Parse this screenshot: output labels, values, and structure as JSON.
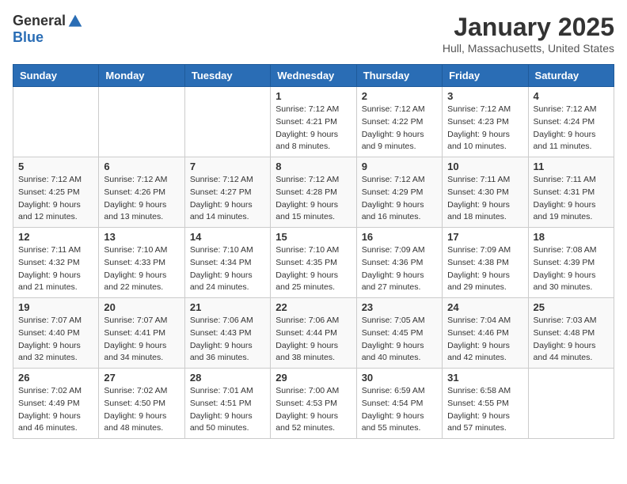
{
  "header": {
    "logo_general": "General",
    "logo_blue": "Blue",
    "month": "January 2025",
    "location": "Hull, Massachusetts, United States"
  },
  "weekdays": [
    "Sunday",
    "Monday",
    "Tuesday",
    "Wednesday",
    "Thursday",
    "Friday",
    "Saturday"
  ],
  "weeks": [
    [
      {
        "day": "",
        "info": ""
      },
      {
        "day": "",
        "info": ""
      },
      {
        "day": "",
        "info": ""
      },
      {
        "day": "1",
        "info": "Sunrise: 7:12 AM\nSunset: 4:21 PM\nDaylight: 9 hours\nand 8 minutes."
      },
      {
        "day": "2",
        "info": "Sunrise: 7:12 AM\nSunset: 4:22 PM\nDaylight: 9 hours\nand 9 minutes."
      },
      {
        "day": "3",
        "info": "Sunrise: 7:12 AM\nSunset: 4:23 PM\nDaylight: 9 hours\nand 10 minutes."
      },
      {
        "day": "4",
        "info": "Sunrise: 7:12 AM\nSunset: 4:24 PM\nDaylight: 9 hours\nand 11 minutes."
      }
    ],
    [
      {
        "day": "5",
        "info": "Sunrise: 7:12 AM\nSunset: 4:25 PM\nDaylight: 9 hours\nand 12 minutes."
      },
      {
        "day": "6",
        "info": "Sunrise: 7:12 AM\nSunset: 4:26 PM\nDaylight: 9 hours\nand 13 minutes."
      },
      {
        "day": "7",
        "info": "Sunrise: 7:12 AM\nSunset: 4:27 PM\nDaylight: 9 hours\nand 14 minutes."
      },
      {
        "day": "8",
        "info": "Sunrise: 7:12 AM\nSunset: 4:28 PM\nDaylight: 9 hours\nand 15 minutes."
      },
      {
        "day": "9",
        "info": "Sunrise: 7:12 AM\nSunset: 4:29 PM\nDaylight: 9 hours\nand 16 minutes."
      },
      {
        "day": "10",
        "info": "Sunrise: 7:11 AM\nSunset: 4:30 PM\nDaylight: 9 hours\nand 18 minutes."
      },
      {
        "day": "11",
        "info": "Sunrise: 7:11 AM\nSunset: 4:31 PM\nDaylight: 9 hours\nand 19 minutes."
      }
    ],
    [
      {
        "day": "12",
        "info": "Sunrise: 7:11 AM\nSunset: 4:32 PM\nDaylight: 9 hours\nand 21 minutes."
      },
      {
        "day": "13",
        "info": "Sunrise: 7:10 AM\nSunset: 4:33 PM\nDaylight: 9 hours\nand 22 minutes."
      },
      {
        "day": "14",
        "info": "Sunrise: 7:10 AM\nSunset: 4:34 PM\nDaylight: 9 hours\nand 24 minutes."
      },
      {
        "day": "15",
        "info": "Sunrise: 7:10 AM\nSunset: 4:35 PM\nDaylight: 9 hours\nand 25 minutes."
      },
      {
        "day": "16",
        "info": "Sunrise: 7:09 AM\nSunset: 4:36 PM\nDaylight: 9 hours\nand 27 minutes."
      },
      {
        "day": "17",
        "info": "Sunrise: 7:09 AM\nSunset: 4:38 PM\nDaylight: 9 hours\nand 29 minutes."
      },
      {
        "day": "18",
        "info": "Sunrise: 7:08 AM\nSunset: 4:39 PM\nDaylight: 9 hours\nand 30 minutes."
      }
    ],
    [
      {
        "day": "19",
        "info": "Sunrise: 7:07 AM\nSunset: 4:40 PM\nDaylight: 9 hours\nand 32 minutes."
      },
      {
        "day": "20",
        "info": "Sunrise: 7:07 AM\nSunset: 4:41 PM\nDaylight: 9 hours\nand 34 minutes."
      },
      {
        "day": "21",
        "info": "Sunrise: 7:06 AM\nSunset: 4:43 PM\nDaylight: 9 hours\nand 36 minutes."
      },
      {
        "day": "22",
        "info": "Sunrise: 7:06 AM\nSunset: 4:44 PM\nDaylight: 9 hours\nand 38 minutes."
      },
      {
        "day": "23",
        "info": "Sunrise: 7:05 AM\nSunset: 4:45 PM\nDaylight: 9 hours\nand 40 minutes."
      },
      {
        "day": "24",
        "info": "Sunrise: 7:04 AM\nSunset: 4:46 PM\nDaylight: 9 hours\nand 42 minutes."
      },
      {
        "day": "25",
        "info": "Sunrise: 7:03 AM\nSunset: 4:48 PM\nDaylight: 9 hours\nand 44 minutes."
      }
    ],
    [
      {
        "day": "26",
        "info": "Sunrise: 7:02 AM\nSunset: 4:49 PM\nDaylight: 9 hours\nand 46 minutes."
      },
      {
        "day": "27",
        "info": "Sunrise: 7:02 AM\nSunset: 4:50 PM\nDaylight: 9 hours\nand 48 minutes."
      },
      {
        "day": "28",
        "info": "Sunrise: 7:01 AM\nSunset: 4:51 PM\nDaylight: 9 hours\nand 50 minutes."
      },
      {
        "day": "29",
        "info": "Sunrise: 7:00 AM\nSunset: 4:53 PM\nDaylight: 9 hours\nand 52 minutes."
      },
      {
        "day": "30",
        "info": "Sunrise: 6:59 AM\nSunset: 4:54 PM\nDaylight: 9 hours\nand 55 minutes."
      },
      {
        "day": "31",
        "info": "Sunrise: 6:58 AM\nSunset: 4:55 PM\nDaylight: 9 hours\nand 57 minutes."
      },
      {
        "day": "",
        "info": ""
      }
    ]
  ]
}
